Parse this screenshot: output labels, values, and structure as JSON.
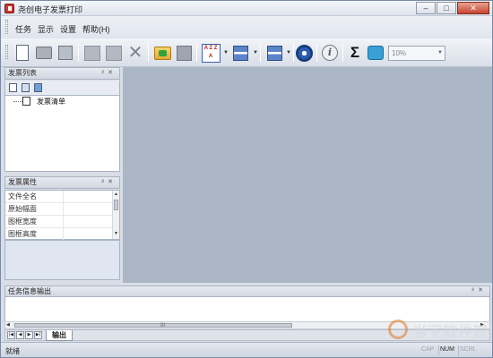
{
  "window": {
    "title": "尧创电子发票打印",
    "controls": {
      "minimize": "–",
      "maximize": "□",
      "close": "✕"
    }
  },
  "menu": [
    {
      "label": "任务"
    },
    {
      "label": "显示"
    },
    {
      "label": "设置"
    },
    {
      "label": "帮助(H)"
    }
  ],
  "toolbar": {
    "icons": [
      "new-document-icon",
      "print-icon",
      "print-preview-icon",
      "batch-print-icon",
      "open-folder-icon",
      "delete-icon",
      "import-icon",
      "save-icon",
      "sort-az-icon",
      "layout-icon",
      "align-icon",
      "settings-icon",
      "info-icon",
      "sum-icon",
      "zoom-icon"
    ],
    "sort_label": "A Z Z A",
    "info_label": "i",
    "sum_label": "Σ",
    "zoom_value": "10%"
  },
  "invoice_list_panel": {
    "title": "发票列表",
    "pin": "ᵖ",
    "close": "✕",
    "tree": [
      {
        "label": "发票清单"
      }
    ]
  },
  "invoice_props_panel": {
    "title": "发票属性",
    "pin": "ᵖ",
    "close": "✕",
    "rows": [
      {
        "name": "文件全名"
      },
      {
        "name": "原始幅面"
      },
      {
        "name": "图框宽度"
      },
      {
        "name": "图框高度"
      }
    ]
  },
  "output_panel": {
    "title": "任务信息输出",
    "pin": "ᵖ",
    "close": "✕",
    "scroll_grip": "III",
    "tab": "输出",
    "nav": {
      "first": "|◀",
      "prev": "◀",
      "next": "▶",
      "last": "▶|"
    }
  },
  "statusbar": {
    "text": "就绪",
    "indicators": [
      {
        "label": "CAP",
        "active": false
      },
      {
        "label": "NUM",
        "active": true
      },
      {
        "label": "SCRL",
        "active": false
      }
    ]
  },
  "watermark": {
    "title": "当下软件园",
    "url": "www.downxia.com"
  },
  "colors": {
    "workspace": "#abb6c7",
    "close_button": "#c64531",
    "chrome": "#d8dde6"
  }
}
